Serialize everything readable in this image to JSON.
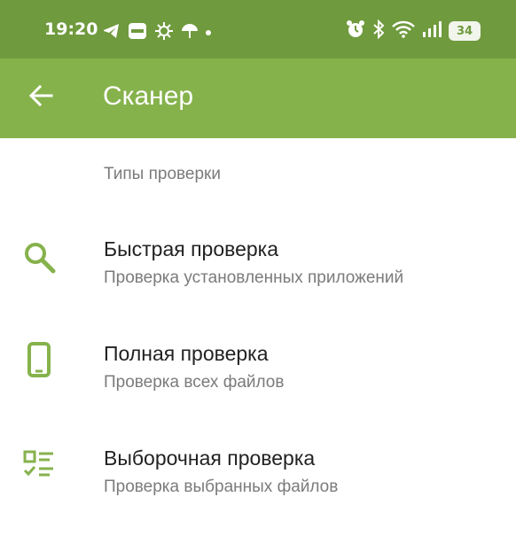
{
  "status_bar": {
    "time": "19:20",
    "battery": "34",
    "icons_left": [
      "telegram-icon",
      "app-badge-icon",
      "virus-icon",
      "umbrella-icon",
      "dot-icon"
    ],
    "icons_right": [
      "alarm-icon",
      "bluetooth-icon",
      "wifi-icon",
      "signal-icon",
      "battery-icon"
    ]
  },
  "app_bar": {
    "title": "Сканер",
    "back_icon": "arrow-back-icon"
  },
  "section": {
    "header": "Типы проверки"
  },
  "scan_items": [
    {
      "title": "Быстрая проверка",
      "subtitle": "Проверка установленных приложений",
      "icon": "search-icon"
    },
    {
      "title": "Полная проверка",
      "subtitle": "Проверка всех файлов",
      "icon": "phone-icon"
    },
    {
      "title": "Выборочная проверка",
      "subtitle": "Проверка выбранных файлов",
      "icon": "checklist-icon"
    }
  ],
  "colors": {
    "status_bar": "#6f9a3d",
    "app_bar": "#86b24c",
    "accent": "#86b24c",
    "title_text": "#222222",
    "secondary_text": "#7b7b7b"
  }
}
